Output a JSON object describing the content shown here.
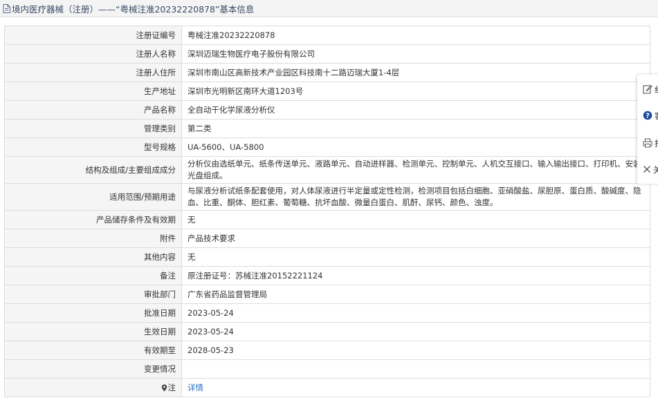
{
  "header": {
    "title": "境内医疗器械（注册）——“粤械注准20232220878”基本信息"
  },
  "rows": [
    {
      "label": "注册证编号",
      "value": "粤械注准20232220878"
    },
    {
      "label": "注册人名称",
      "value": "深圳迈瑞生物医疗电子股份有限公司"
    },
    {
      "label": "注册人住所",
      "value": "深圳市南山区高新技术产业园区科技南十二路迈瑞大厦1-4层"
    },
    {
      "label": "生产地址",
      "value": "深圳市光明新区南环大道1203号"
    },
    {
      "label": "产品名称",
      "value": "全自动干化学尿液分析仪"
    },
    {
      "label": "管理类别",
      "value": "第二类"
    },
    {
      "label": "型号规格",
      "value": "UA-5600、UA-5800"
    },
    {
      "label": "结构及组成/主要组成成分",
      "value": "分析仪由选纸单元、纸条传送单元、液路单元、自动进样器、检测单元、控制单元、人机交互接口、输入输出接口、打印机、安装光盘组成。"
    },
    {
      "label": "适用范围/预期用途",
      "value": "与尿液分析试纸条配套使用，对人体尿液进行半定量或定性检测，检测项目包括白细胞、亚硝酸盐、尿胆原、蛋白质、酸碱度、隐血、比重、酮体、胆红素、葡萄糖、抗坏血酸、微量白蛋白、肌酐、尿钙、颜色、浊度。"
    },
    {
      "label": "产品储存条件及有效期",
      "value": "无"
    },
    {
      "label": "附件",
      "value": "产品技术要求"
    },
    {
      "label": "其他内容",
      "value": "无"
    },
    {
      "label": "备注",
      "value": "原注册证号：苏械注准20152221124"
    },
    {
      "label": "审批部门",
      "value": "广东省药品监督管理局"
    },
    {
      "label": "批准日期",
      "value": "2023-05-24"
    },
    {
      "label": "生效日期",
      "value": "2023-05-24"
    },
    {
      "label": "有效期至",
      "value": "2028-05-23"
    },
    {
      "label": "变更情况",
      "value": ""
    }
  ],
  "note_row": {
    "label": "注",
    "link": "详情"
  },
  "float_bar": [
    {
      "icon": "edit-icon",
      "label": "纠"
    },
    {
      "icon": "help-icon",
      "label": "客"
    },
    {
      "icon": "print-icon",
      "label": "打"
    },
    {
      "icon": "close-icon",
      "label": "关"
    }
  ]
}
